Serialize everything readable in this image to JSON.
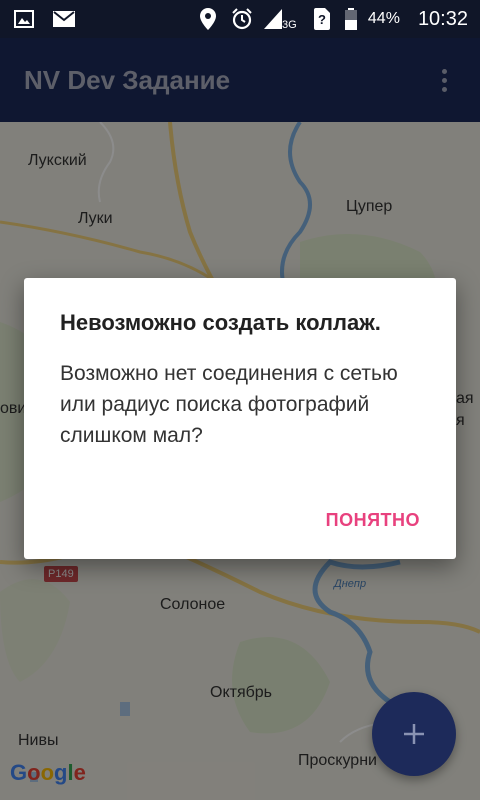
{
  "status_bar": {
    "battery_pct": "44%",
    "time": "10:32",
    "network": "3G"
  },
  "app_bar": {
    "title": "NV Dev Задание"
  },
  "map": {
    "labels": {
      "luksky": "Лукский",
      "luki": "Луки",
      "tsuper": "Цупер",
      "solonoe": "Солоное",
      "oktyabr": "Октябрь",
      "nivy": "Нивы",
      "proskurni": "Проскурни",
      "ovi": "ови",
      "aya": "ая",
      "ya": "я",
      "river": "Днепр",
      "road": "Р149"
    },
    "google": [
      "G",
      "o",
      "o",
      "g",
      "l",
      "e"
    ],
    "google_colors": [
      "#4285F4",
      "#EA4335",
      "#FBBC05",
      "#4285F4",
      "#34A853",
      "#EA4335"
    ]
  },
  "dialog": {
    "title": "Невозможно создать коллаж.",
    "message": "Возможно нет соединения с сетью или радиус поиска фотографий слишком мал?",
    "button": "ПОНЯТНО"
  },
  "fab": {
    "icon": "plus-icon"
  }
}
